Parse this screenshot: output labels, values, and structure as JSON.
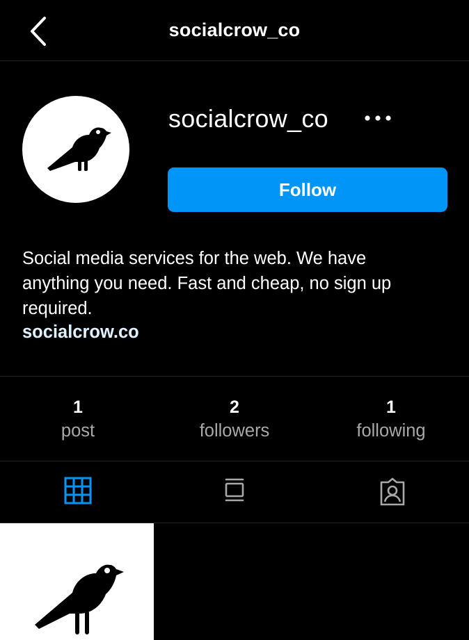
{
  "header": {
    "title": "socialcrow_co",
    "back_icon": "chevron-left-icon"
  },
  "profile": {
    "username": "socialcrow_co",
    "avatar_icon": "crow-logo-icon",
    "more_icon": "more-horizontal-icon",
    "follow_label": "Follow",
    "bio_line_1": "Social media services for the web. We have",
    "bio_line_2": "anything you need. Fast and cheap, no sign up",
    "bio_line_3": "required.",
    "website": "socialcrow.co"
  },
  "stats": [
    {
      "value": "1",
      "label": "post"
    },
    {
      "value": "2",
      "label": "followers"
    },
    {
      "value": "1",
      "label": "following"
    }
  ],
  "tabs": [
    {
      "name": "posts-grid",
      "icon": "grid-icon",
      "active": true
    },
    {
      "name": "feed",
      "icon": "feed-icon",
      "active": false
    },
    {
      "name": "tagged",
      "icon": "tagged-user-icon",
      "active": false
    }
  ],
  "colors": {
    "background": "#000000",
    "follow_button": "#0095f6",
    "active_tab_icon": "#0095f6",
    "inactive_tab_icon": "#a8a8a8",
    "muted_text": "#a8a8a8",
    "divider": "#262626"
  },
  "posts": [
    {
      "image": "crow-logo-post"
    }
  ]
}
